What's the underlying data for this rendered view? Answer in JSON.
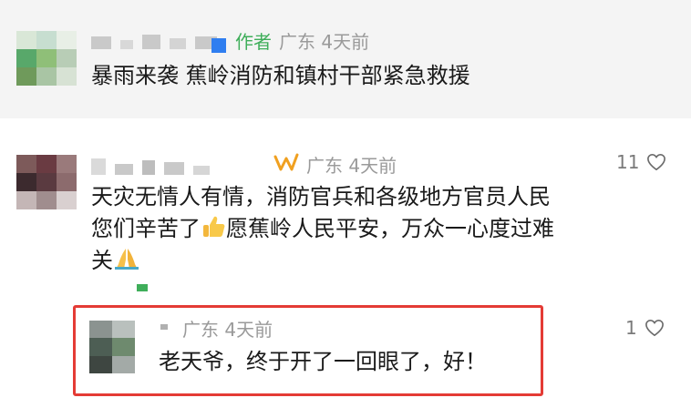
{
  "author_comment": {
    "author_tag": "作者",
    "location_time": "广东 4天前",
    "text": "暴雨来袭 蕉岭消防和镇村干部紧急救援"
  },
  "comment_1": {
    "location_time": "广东 4天前",
    "text_line1": "天灾无情人有情，消防官兵和各级地方官员人民",
    "text_line2a": "您们辛苦了",
    "text_line2b": "愿蕉岭人民平安，万众一心度过难",
    "text_line3": "关",
    "likes": "11",
    "badge_icon": "wave-badge-icon",
    "emoji_1": "thumbs-up-icon",
    "emoji_2": "praying-hands-icon"
  },
  "comment_2": {
    "location_time": "广东 4天前",
    "text": "老天爷，终于开了一回眼了，好！",
    "likes": "1"
  },
  "colors": {
    "author_tag": "#3fae5a",
    "highlight": "#e43b35",
    "meta": "#9a9a9a"
  }
}
